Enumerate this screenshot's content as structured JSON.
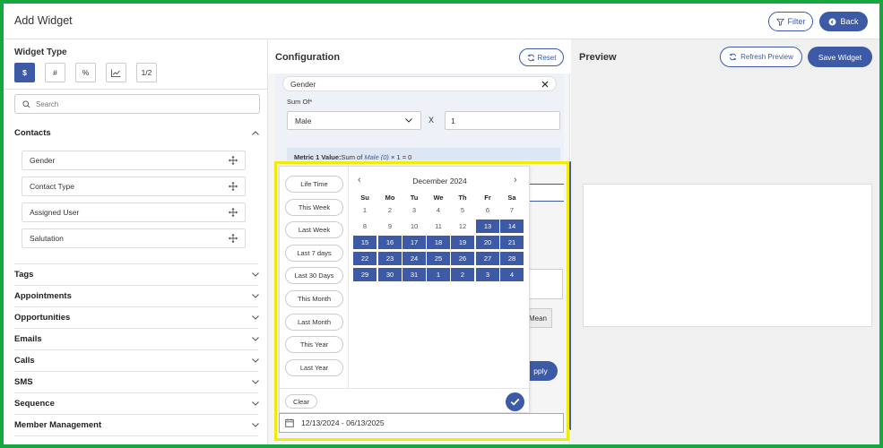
{
  "header": {
    "title": "Add Widget",
    "filter_label": "Filter",
    "back_label": "Back"
  },
  "left": {
    "widget_type_title": "Widget Type",
    "widget_types": [
      {
        "label": "$",
        "active": true
      },
      {
        "label": "#",
        "active": false
      },
      {
        "label": "%",
        "active": false
      },
      {
        "label": "",
        "icon": "line-chart-icon",
        "active": false
      },
      {
        "label": "1/2",
        "active": false
      }
    ],
    "search_placeholder": "Search",
    "contacts_label": "Contacts",
    "contact_fields": [
      "Gender",
      "Contact Type",
      "Assigned User",
      "Salutation"
    ],
    "sections": [
      "Tags",
      "Appointments",
      "Opportunities",
      "Emails",
      "Calls",
      "SMS",
      "Sequence",
      "Member Management"
    ]
  },
  "config": {
    "title": "Configuration",
    "reset_label": "Reset",
    "gender_value": "Gender",
    "sum_of_label": "Sum Of*",
    "sum_of_value": "Male",
    "x_label": "X",
    "multiplier_value": "1",
    "metric_label": "Metric 1 Value:",
    "metric_text_pre": "Sum of ",
    "metric_var": "Male (0)",
    "metric_text_post": " × 1 = 0",
    "mean_label": "Mean",
    "apply_label": "pply"
  },
  "datepicker": {
    "ranges": [
      "Life Time",
      "This Week",
      "Last Week",
      "Last 7 days",
      "Last 30 Days",
      "This Month",
      "Last Month",
      "This Year",
      "Last Year"
    ],
    "month_label": "December 2024",
    "weekdays": [
      "Su",
      "Mo",
      "Tu",
      "We",
      "Th",
      "Fr",
      "Sa"
    ],
    "weeks": [
      [
        "1",
        "2",
        "3",
        "4",
        "5",
        "6",
        "7"
      ],
      [
        "8",
        "9",
        "10",
        "11",
        "12",
        "13",
        "14"
      ],
      [
        "15",
        "16",
        "17",
        "18",
        "19",
        "20",
        "21"
      ],
      [
        "22",
        "23",
        "24",
        "25",
        "26",
        "27",
        "28"
      ],
      [
        "29",
        "30",
        "31",
        "1",
        "2",
        "3",
        "4"
      ]
    ],
    "selected_from": "13",
    "clear_label": "Clear",
    "range_value": "12/13/2024 - 06/13/2025"
  },
  "preview": {
    "title": "Preview",
    "refresh_label": "Refresh Preview",
    "save_label": "Save Widget"
  },
  "colors": {
    "accent": "#3d5aa6",
    "frame_border": "#14a83e",
    "highlight": "#f2ea0c"
  }
}
